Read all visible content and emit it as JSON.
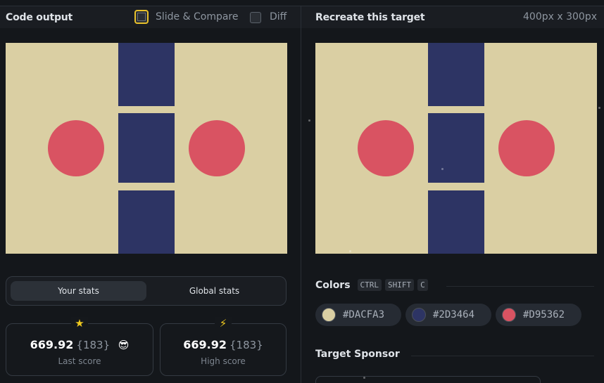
{
  "left_panel": {
    "title": "Code output",
    "slide_compare_label": "Slide & Compare",
    "diff_label": "Diff"
  },
  "right_panel": {
    "title": "Recreate this target",
    "dimensions": "400px x 300px"
  },
  "canvas_colors": {
    "background": "#DACFA3",
    "blocks": "#2D3464",
    "circles": "#D95362"
  },
  "stats_tabs": {
    "your_stats": "Your stats",
    "global_stats": "Global stats",
    "active": "Your stats"
  },
  "stats": {
    "last_score": {
      "icon": "star-icon",
      "icon_glyph": "★",
      "value": "669.92",
      "count": "{183}",
      "emoji": "😎",
      "label": "Last score"
    },
    "high_score": {
      "icon": "lightning-icon",
      "icon_glyph": "⚡",
      "value": "669.92",
      "count": "{183}",
      "label": "High score"
    }
  },
  "colors_section": {
    "title": "Colors",
    "shortcut": [
      "CTRL",
      "SHIFT",
      "C"
    ],
    "swatches": [
      {
        "hex": "#DACFA3",
        "label": "#DACFA3"
      },
      {
        "hex": "#2D3464",
        "label": "#2D3464"
      },
      {
        "hex": "#D95362",
        "label": "#D95362"
      }
    ]
  },
  "sponsor_section": {
    "title": "Target Sponsor"
  }
}
